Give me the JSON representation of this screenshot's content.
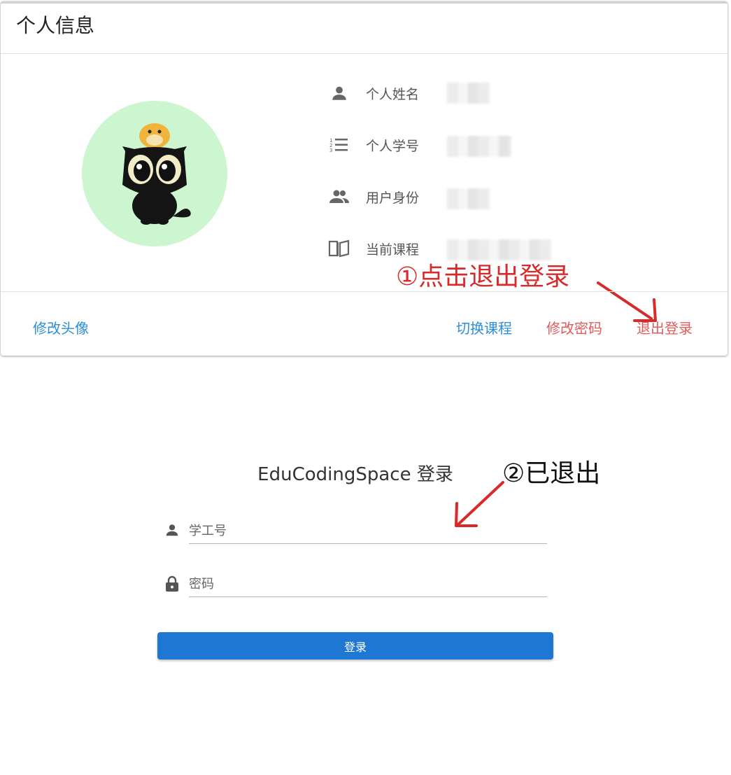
{
  "profile_card": {
    "title": "个人信息",
    "fields": [
      {
        "label": "个人姓名",
        "icon": "person-icon"
      },
      {
        "label": "个人学号",
        "icon": "numbered-list-icon"
      },
      {
        "label": "用户身份",
        "icon": "group-icon"
      },
      {
        "label": "当前课程",
        "icon": "book-icon"
      }
    ],
    "actions": {
      "change_avatar": "修改头像",
      "switch_course": "切换课程",
      "change_password": "修改密码",
      "logout": "退出登录"
    }
  },
  "annotations": {
    "step1": "①点击退出登录",
    "step2": "②已退出"
  },
  "login": {
    "title": "EduCodingSpace 登录",
    "username_placeholder": "学工号",
    "password_placeholder": "密码",
    "submit_label": "登录"
  },
  "colors": {
    "link_blue": "#2b8fd6",
    "link_red": "#e35b5b",
    "annotation_red": "#d82a2a",
    "button_blue": "#1e78d3",
    "avatar_bg": "#ccf6d0"
  }
}
